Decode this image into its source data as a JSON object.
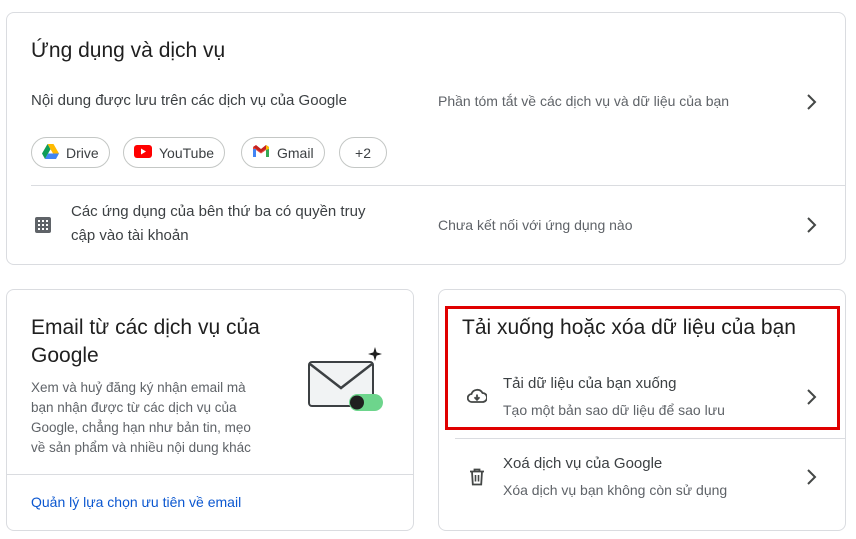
{
  "apps_card": {
    "title": "Ứng dụng và dịch vụ",
    "content_row": {
      "label": "Nội dung được lưu trên các dịch vụ của Google",
      "summary": "Phần tóm tắt về các dịch vụ và dữ liệu của bạn"
    },
    "chips": [
      {
        "label": "Drive",
        "icon": "google-drive-icon"
      },
      {
        "label": "YouTube",
        "icon": "youtube-icon"
      },
      {
        "label": "Gmail",
        "icon": "gmail-icon"
      },
      {
        "label": "+2"
      }
    ],
    "third_party_row": {
      "label_line1": "Các ứng dụng của bên thứ ba có quyền truy",
      "label_line2": "cập vào tài khoản",
      "status": "Chưa kết nối với ứng dụng nào",
      "icon": "apps-grid-icon"
    }
  },
  "email_card": {
    "title_line1": "Email từ các dịch vụ của",
    "title_line2": "Google",
    "desc_lines": [
      "Xem và huỷ đăng ký nhận email mà",
      "bạn nhận được từ các dịch vụ của",
      "Google, chẳng hạn như bản tin, mẹo",
      "về sản phẩm và nhiều nội dung khác"
    ],
    "link": "Quản lý lựa chọn ưu tiên về email",
    "illustration": "email-toggle-illustration"
  },
  "data_card": {
    "title": "Tải xuống hoặc xóa dữ liệu của bạn",
    "download": {
      "label": "Tải dữ liệu của bạn xuống",
      "sub": "Tạo một bản sao dữ liệu để sao lưu",
      "icon": "cloud-download-icon"
    },
    "delete": {
      "label": "Xoá dịch vụ của Google",
      "sub": "Xóa dịch vụ bạn không còn sử dụng",
      "icon": "trash-icon"
    }
  },
  "colors": {
    "highlight": "#e00000",
    "link": "#0b57d0",
    "toggle_on": "#6dd58c"
  }
}
